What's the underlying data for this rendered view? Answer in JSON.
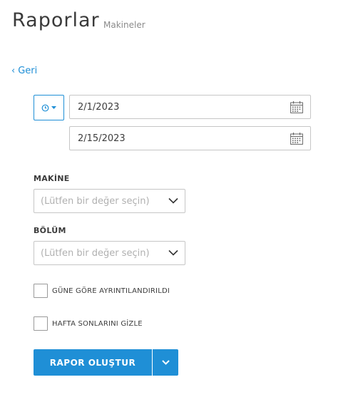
{
  "header": {
    "title": "Raporlar",
    "subtitle": "Makineler"
  },
  "nav": {
    "back_label": "Geri"
  },
  "date_range": {
    "from_value": "2/1/2023",
    "to_value": "2/15/2023",
    "range_icon": "clock-icon"
  },
  "machine": {
    "label": "MAKİNE",
    "placeholder": "(Lütfen bir değer seçin)"
  },
  "section": {
    "label": "BÖLÜM",
    "placeholder": "(Lütfen bir değer seçin)"
  },
  "options": {
    "detail_by_day": {
      "label": "GÜNE GÖRE AYRINTILANDIRILDI",
      "checked": false
    },
    "hide_weekends": {
      "label": "HAFTA SONLARINI GİZLE",
      "checked": false
    }
  },
  "actions": {
    "create_report_label": "RAPOR OLUŞTUR"
  },
  "colors": {
    "accent": "#1f8fd6",
    "text": "#3c3c3c",
    "placeholder": "#b0b0b0"
  }
}
